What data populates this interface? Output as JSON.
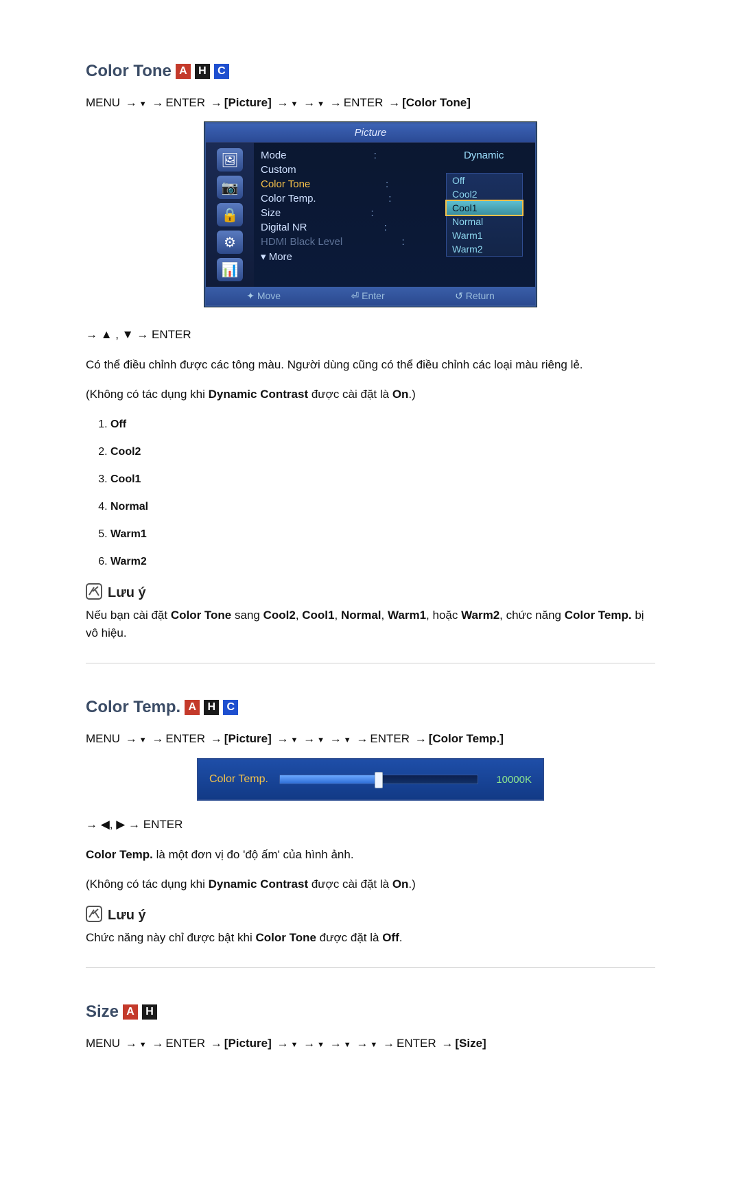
{
  "badges": {
    "a": "A",
    "h": "H",
    "c": "C"
  },
  "nav_tokens": {
    "menu": "MENU",
    "enter": "ENTER",
    "picture_br": "[Picture]",
    "color_tone_br": "[Color Tone]",
    "color_temp_br": "[Color Temp.]",
    "size_br": "[Size]"
  },
  "section1": {
    "title": "Color Tone",
    "post_nav": "→ ▲ , ▼ → ENTER",
    "p1": "Có thể điều chỉnh được các tông màu. Người dùng cũng có thể điều chỉnh các loại màu riêng lẻ.",
    "p2_pre": "(Không có tác dụng khi ",
    "p2_b": "Dynamic Contrast",
    "p2_mid": " được cài đặt là ",
    "p2_b2": "On",
    "p2_post": ".)",
    "options": [
      "Off",
      "Cool2",
      "Cool1",
      "Normal",
      "Warm1",
      "Warm2"
    ],
    "note_title": "Lưu ý",
    "note_pre": "Nếu bạn cài đặt ",
    "note_b1": "Color Tone",
    "note_mid1": " sang ",
    "note_b2": "Cool2",
    "note_c": ", ",
    "note_b3": "Cool1",
    "note_b4": "Normal",
    "note_b5": "Warm1",
    "note_mid2": ", hoặc ",
    "note_b6": "Warm2",
    "note_mid3": ", chức năng ",
    "note_b7": "Color Temp.",
    "note_post": " bị vô hiệu."
  },
  "osd": {
    "title": "Picture",
    "rows": {
      "mode": "Mode",
      "mode_val": "Dynamic",
      "custom": "Custom",
      "color_tone": "Color Tone",
      "color_temp": "Color Temp.",
      "size": "Size",
      "digital_nr": "Digital NR",
      "hdmi_bl": "HDMI Black Level",
      "more": "More"
    },
    "dropdown": [
      "Off",
      "Cool2",
      "Cool1",
      "Normal",
      "Warm1",
      "Warm2"
    ],
    "footer": {
      "move": "Move",
      "enter": "Enter",
      "return": "Return"
    }
  },
  "section2": {
    "title": "Color Temp.",
    "post_nav": "→ ◀, ▶ → ENTER",
    "slider_label": "Color Temp.",
    "slider_value": "10000K",
    "p1_b": "Color Temp.",
    "p1_rest": " là một đơn vị đo 'độ ấm' của hình ảnh.",
    "p2_pre": "(Không có tác dụng khi ",
    "p2_b": "Dynamic Contrast",
    "p2_mid": " được cài đặt là ",
    "p2_b2": "On",
    "p2_post": ".)",
    "note_title": "Lưu ý",
    "note_pre": "Chức năng này chỉ được bật khi ",
    "note_b1": "Color Tone",
    "note_mid": " được đặt là ",
    "note_b2": "Off",
    "note_post": "."
  },
  "section3": {
    "title": "Size"
  }
}
